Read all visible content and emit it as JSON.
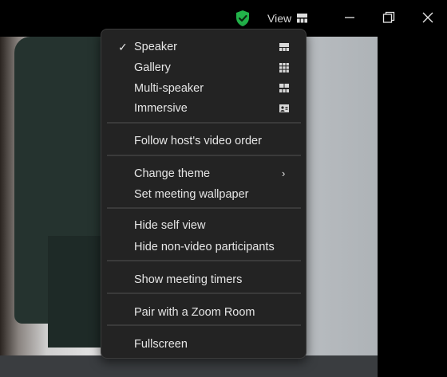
{
  "titlebar": {
    "view_label": "View",
    "icons": [
      "shield-check-icon",
      "view-layout-icon",
      "minimize-icon",
      "restore-icon",
      "close-icon"
    ],
    "shield_color": "#22b34a"
  },
  "menu": {
    "layouts": [
      {
        "label": "Speaker",
        "checked": true,
        "icon": "speaker-layout-icon"
      },
      {
        "label": "Gallery",
        "checked": false,
        "icon": "gallery-grid-icon"
      },
      {
        "label": "Multi-speaker",
        "checked": false,
        "icon": "multi-speaker-icon"
      },
      {
        "label": "Immersive",
        "checked": false,
        "icon": "immersive-icon"
      }
    ],
    "follow_host": "Follow host's video order",
    "change_theme": "Change theme",
    "set_wallpaper": "Set meeting wallpaper",
    "hide_self": "Hide self view",
    "hide_non_video": "Hide non-video participants",
    "show_timers": "Show meeting timers",
    "pair_zoom_room": "Pair with a Zoom Room",
    "fullscreen": "Fullscreen",
    "check_glyph": "✓",
    "submenu_glyph": "›"
  }
}
